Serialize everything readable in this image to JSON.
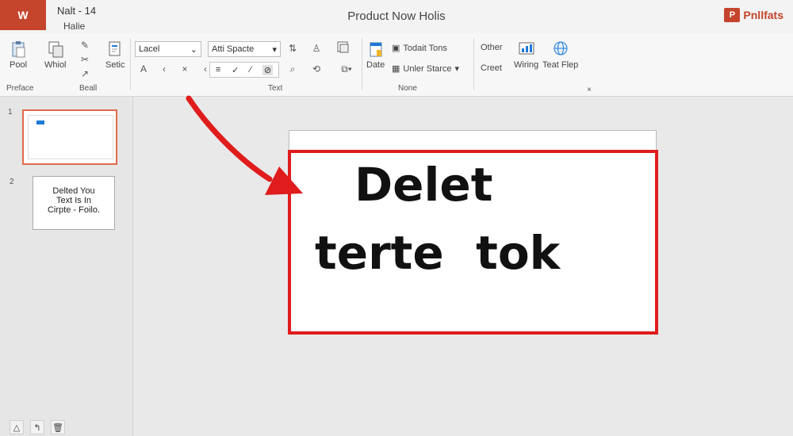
{
  "titlebar": {
    "app_badge": "W",
    "file_name": "Nalt - 14",
    "file_sub": "Halie",
    "doc_title": "Product Now Holis",
    "brand_icon": "P",
    "brand_name": "Pnllfats"
  },
  "ribbon": {
    "buttons": {
      "pool": "Pool",
      "whiol": "Whiol",
      "setic": "Setic",
      "date": "Date",
      "creet": "Creet",
      "wiring": "Wiring",
      "text_flep": "Teat Flep"
    },
    "inline": {
      "todait_tons": "Todait Tons",
      "unler_stacre": "Unler Starce",
      "other": "Other"
    },
    "font_combo": "Lacel",
    "style_combo": "Atti Spacte",
    "group_labels": {
      "preface": "Preface",
      "beall": "Beall",
      "text": "Text",
      "none": "None"
    }
  },
  "slides_panel": {
    "slide1_number": "1",
    "slide2_number": "2",
    "slide2_text": [
      "Delted You",
      "Text Is In",
      "Cirpte - Foilo."
    ]
  },
  "slide": {
    "line1": "Delet",
    "line2": "terte  tok"
  },
  "colors": {
    "accent": "#c5442c",
    "highlight_red": "#e01c1c",
    "selection_blue": "#1e78d7"
  },
  "icons": [
    "paste-icon",
    "copy-icon",
    "format-painter-icon",
    "text-direction-icon",
    "arrow-icon",
    "search-icon",
    "rotate-icon",
    "image-icon",
    "chart-icon",
    "globe-icon"
  ]
}
